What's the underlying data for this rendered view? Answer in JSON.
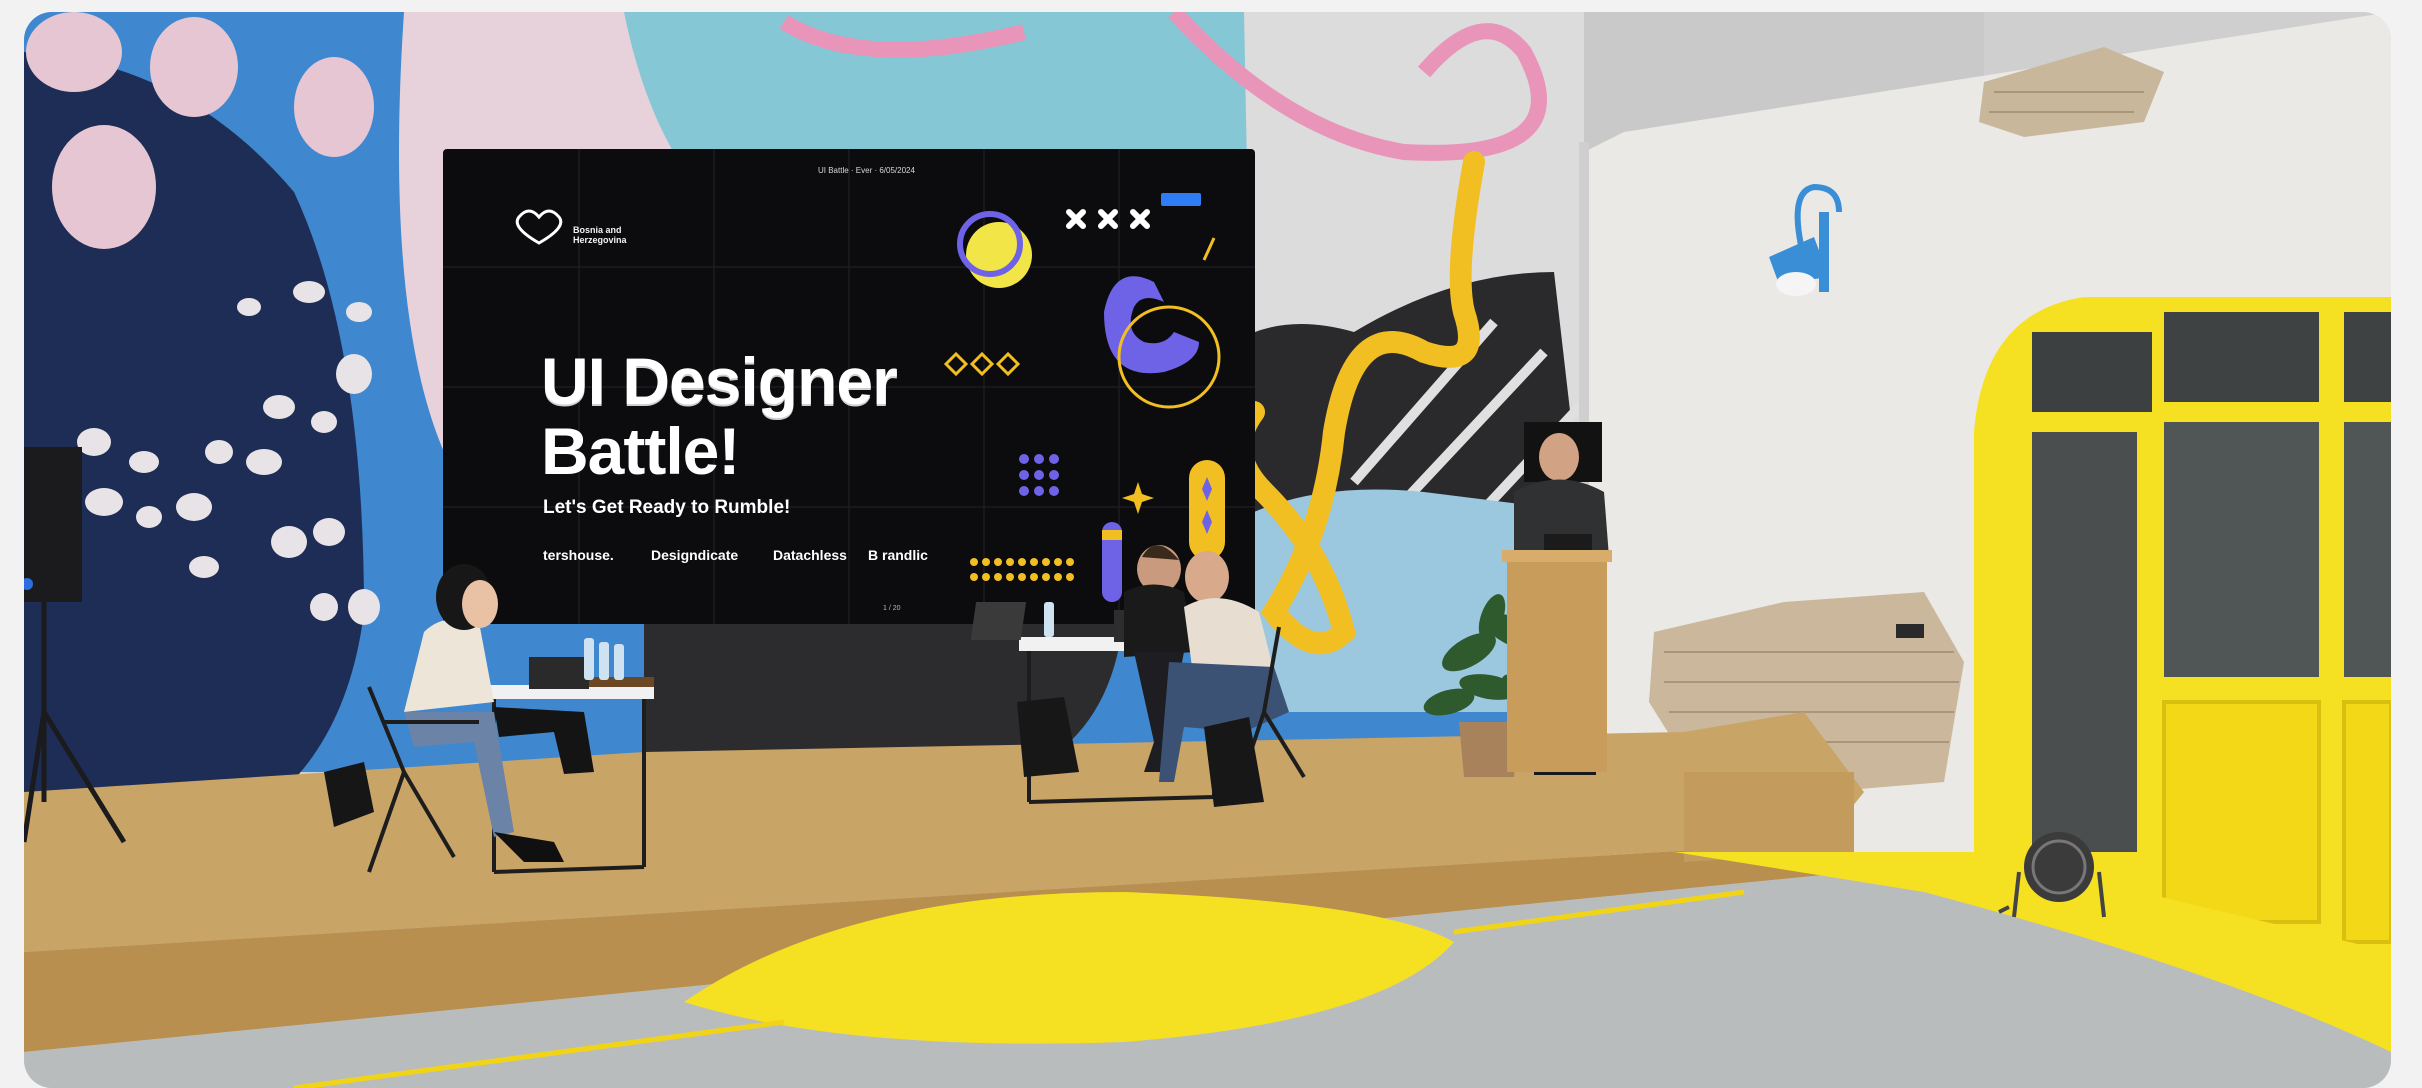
{
  "screen": {
    "topbar_title": "UI Battle · Ever · 6/05/2024",
    "topbar_button": "",
    "logo_text": "Bosnia and Herzegovina",
    "headline_line1": "UI Designer",
    "headline_line2": "Battle!",
    "subtitle": "Let's Get Ready to Rumble!",
    "sponsors": [
      "tershouse.",
      "Designdicate",
      "Datachless",
      "B randlic"
    ],
    "pager": "1 / 20"
  },
  "colors": {
    "mural_navy": "#1e2d55",
    "mural_blue": "#3f88cf",
    "mural_teal": "#86c7d6",
    "mural_pink": "#e994b9",
    "mural_yellow": "#f2bf22",
    "screen_bg": "#0c0c0e",
    "accent_purple": "#6e63e6",
    "stage_osb": "#c9a467",
    "floor_gray": "#b9bcbd",
    "floor_yellow": "#f6e022"
  }
}
